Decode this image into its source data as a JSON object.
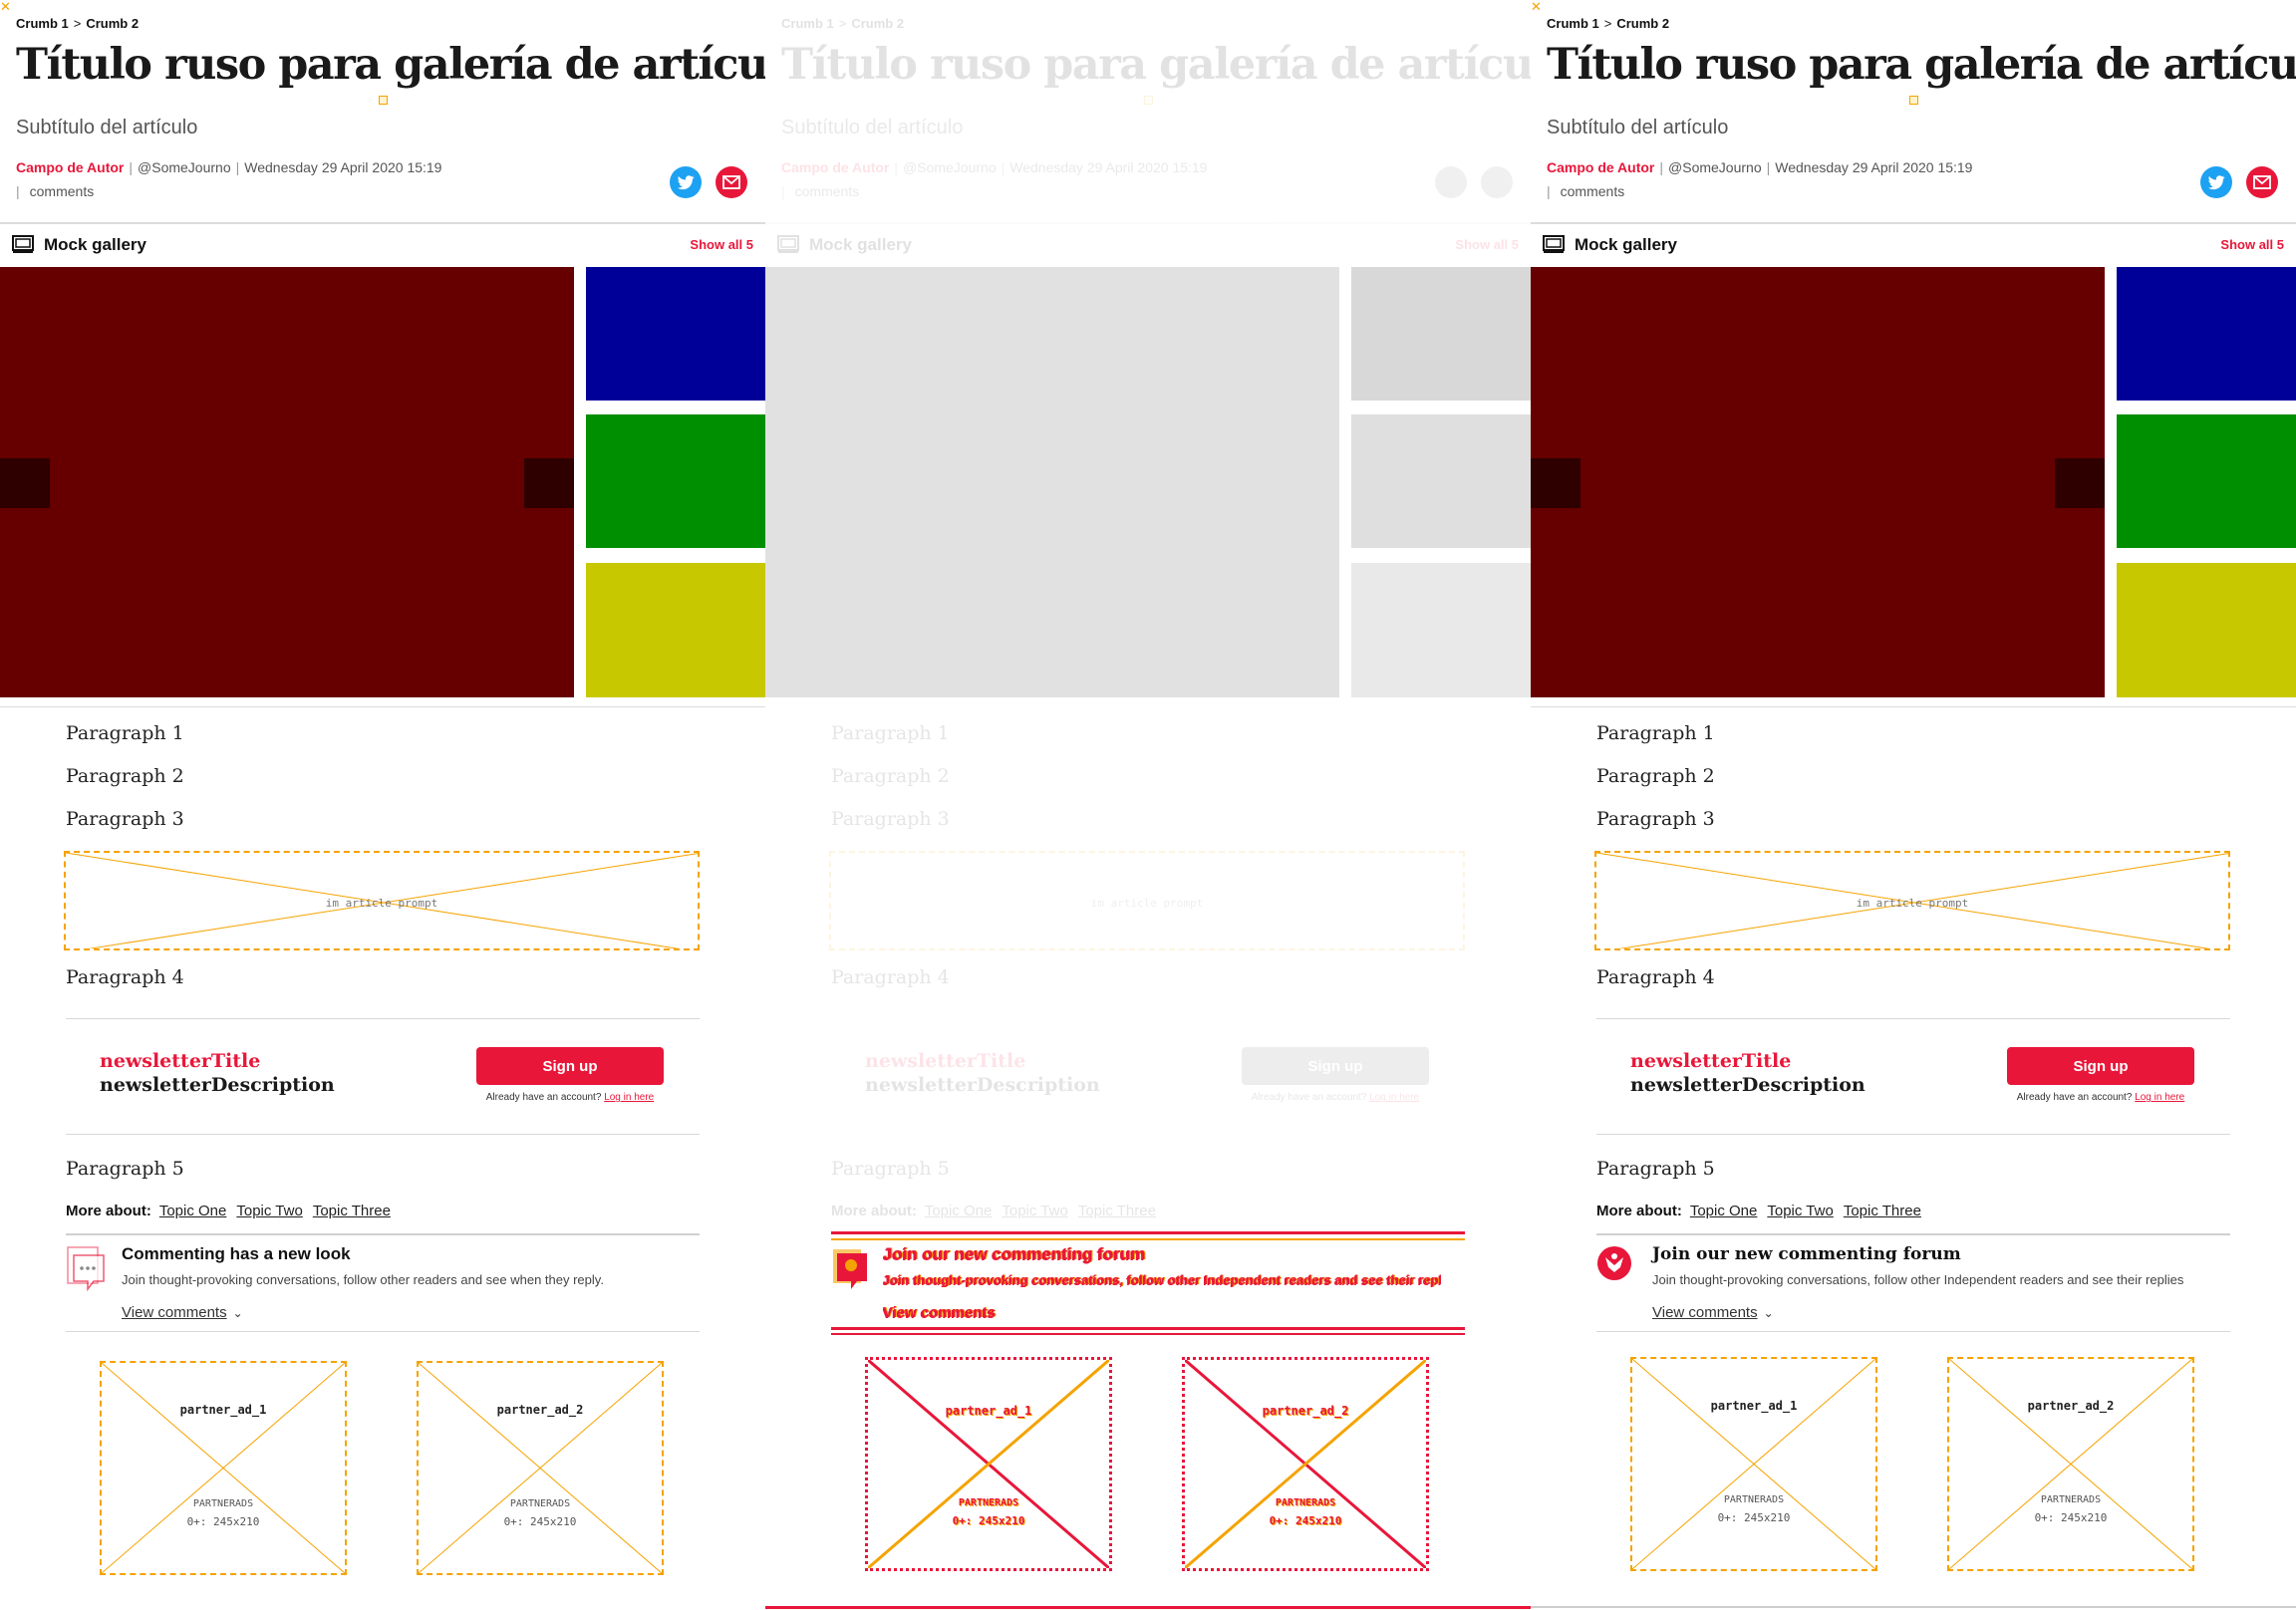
{
  "breadcrumbs": {
    "crumb1": "Crumb 1",
    "separator": ">",
    "crumb2": "Crumb 2"
  },
  "article": {
    "title": "Título ruso para galería de artículos",
    "subtitle": "Subtítulo del artículo",
    "author": "Campo de Autor",
    "handle": "@SomeJourno",
    "date": "Wednesday 29 April 2020 15:19",
    "comments_label": "comments"
  },
  "share": {
    "twitter_icon": "twitter-icon",
    "email_icon": "email-icon",
    "twitter_color": "#1da1f2",
    "email_color": "#e8173a"
  },
  "gallery": {
    "name": "Mock gallery",
    "show_all": "Show all 5",
    "colors": {
      "main": "#660000",
      "thumb1": "#000099",
      "thumb2": "#008f00",
      "thumb3": "#c8c800"
    }
  },
  "body": {
    "paragraph1": "Paragraph 1",
    "paragraph2": "Paragraph 2",
    "paragraph3": "Paragraph 3",
    "prompt_label": "im article prompt",
    "paragraph4": "Paragraph 4",
    "paragraph5": "Paragraph 5"
  },
  "newsletter": {
    "title": "newsletterTitle",
    "description": "newsletterDescription",
    "signup": "Sign up",
    "login_prefix": "Already have an account?",
    "login_link": "Log in here"
  },
  "more_about": {
    "label": "More about:",
    "topics": [
      "Topic One",
      "Topic Two",
      "Topic Three"
    ]
  },
  "commenting": {
    "old": {
      "title": "Commenting has a new look",
      "description": "Join thought-provoking conversations, follow other readers and see when they reply."
    },
    "new": {
      "title": "Join our new commenting forum",
      "description": "Join thought-provoking conversations, follow other Independent readers and see their replies"
    },
    "view": "View comments"
  },
  "ads": [
    {
      "name": "partner_ad_1",
      "type": "PARTNERADS",
      "size": "0+: 245x210"
    },
    {
      "name": "partner_ad_2",
      "type": "PARTNERADS",
      "size": "0+: 245x210"
    }
  ],
  "colors": {
    "accent": "#e8173a",
    "placeholder_border": "#f5a300",
    "rule": "#dcdcdc"
  }
}
